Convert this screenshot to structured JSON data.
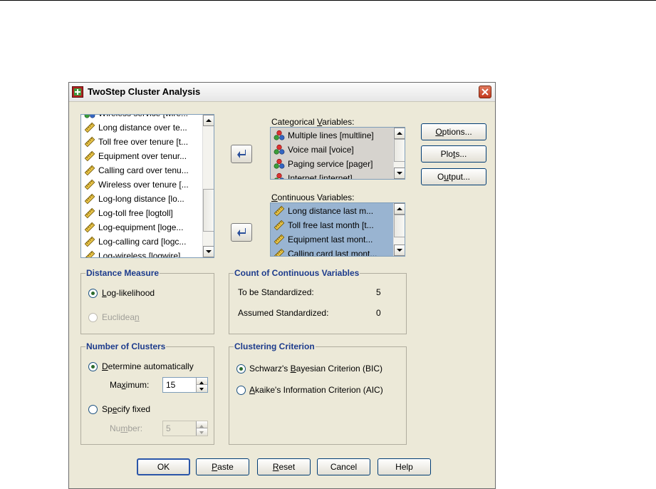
{
  "dialog": {
    "title": "TwoStep Cluster Analysis",
    "source_list": [
      {
        "label": "Wireless service [wire...",
        "icon": "nominal-icon"
      },
      {
        "label": "Long distance over te...",
        "icon": "scale-icon"
      },
      {
        "label": "Toll free over tenure [t...",
        "icon": "scale-icon"
      },
      {
        "label": "Equipment over tenur...",
        "icon": "scale-icon"
      },
      {
        "label": "Calling card over tenu...",
        "icon": "scale-icon"
      },
      {
        "label": "Wireless over tenure [...",
        "icon": "scale-icon"
      },
      {
        "label": "Log-long distance [lo...",
        "icon": "scale-icon"
      },
      {
        "label": "Log-toll free [logtoll]",
        "icon": "scale-icon"
      },
      {
        "label": "Log-equipment [loge...",
        "icon": "scale-icon"
      },
      {
        "label": "Log-calling card [logc...",
        "icon": "scale-icon"
      },
      {
        "label": "Log-wireless [logwire]",
        "icon": "scale-icon"
      }
    ],
    "categorical": {
      "label_pre": "Categorical ",
      "label_u": "V",
      "label_post": "ariables:",
      "items": [
        {
          "label": "Multiple lines [multline]",
          "icon": "nominal-icon"
        },
        {
          "label": "Voice mail [voice]",
          "icon": "nominal-icon"
        },
        {
          "label": "Paging service [pager]",
          "icon": "nominal-icon"
        },
        {
          "label": "Internet [internet]",
          "icon": "nominal-icon"
        }
      ]
    },
    "continuous": {
      "label_pre": "",
      "label_u": "C",
      "label_post": "ontinuous Variables:",
      "items": [
        {
          "label": "Long distance last m...",
          "icon": "scale-icon"
        },
        {
          "label": "Toll free last month [t...",
          "icon": "scale-icon"
        },
        {
          "label": "Equipment last mont...",
          "icon": "scale-icon"
        },
        {
          "label": "Calling card last mont...",
          "icon": "scale-icon"
        }
      ]
    },
    "side_buttons": {
      "options_u": "O",
      "options_rest": "ptions...",
      "plots_pre": "Plo",
      "plots_u": "t",
      "plots_post": "s...",
      "output_pre": "O",
      "output_u": "u",
      "output_post": "tput..."
    },
    "distance_measure": {
      "title": "Distance Measure",
      "loglik_u": "L",
      "loglik_rest": "og-likelihood",
      "euclid_pre": "Euclidea",
      "euclid_u": "n",
      "selected": "Log-likelihood"
    },
    "count": {
      "title": "Count of Continuous Variables",
      "standardized_label": "To be Standardized:",
      "standardized_value": "5",
      "assumed_label": "Assumed Standardized:",
      "assumed_value": "0"
    },
    "num_clusters": {
      "title": "Number of Clusters",
      "auto_u": "D",
      "auto_rest": "etermine automatically",
      "max_pre": "Ma",
      "max_u": "x",
      "max_post": "imum:",
      "max_value": "15",
      "fixed_pre": "Sp",
      "fixed_u": "e",
      "fixed_post": "cify fixed",
      "num_pre": "Nu",
      "num_u": "m",
      "num_post": "ber:",
      "num_value": "5",
      "selected": "Determine automatically"
    },
    "criterion": {
      "title": "Clustering Criterion",
      "bic_pre": "Schwarz's ",
      "bic_u": "B",
      "bic_post": "ayesian Criterion (BIC)",
      "aic_u": "A",
      "aic_post": "kaike's Information Criterion (AIC)",
      "selected": "BIC"
    },
    "footer": {
      "ok": "OK",
      "paste_u": "P",
      "paste_rest": "aste",
      "reset_u": "R",
      "reset_rest": "eset",
      "cancel": "Cancel",
      "help": "Help"
    }
  }
}
